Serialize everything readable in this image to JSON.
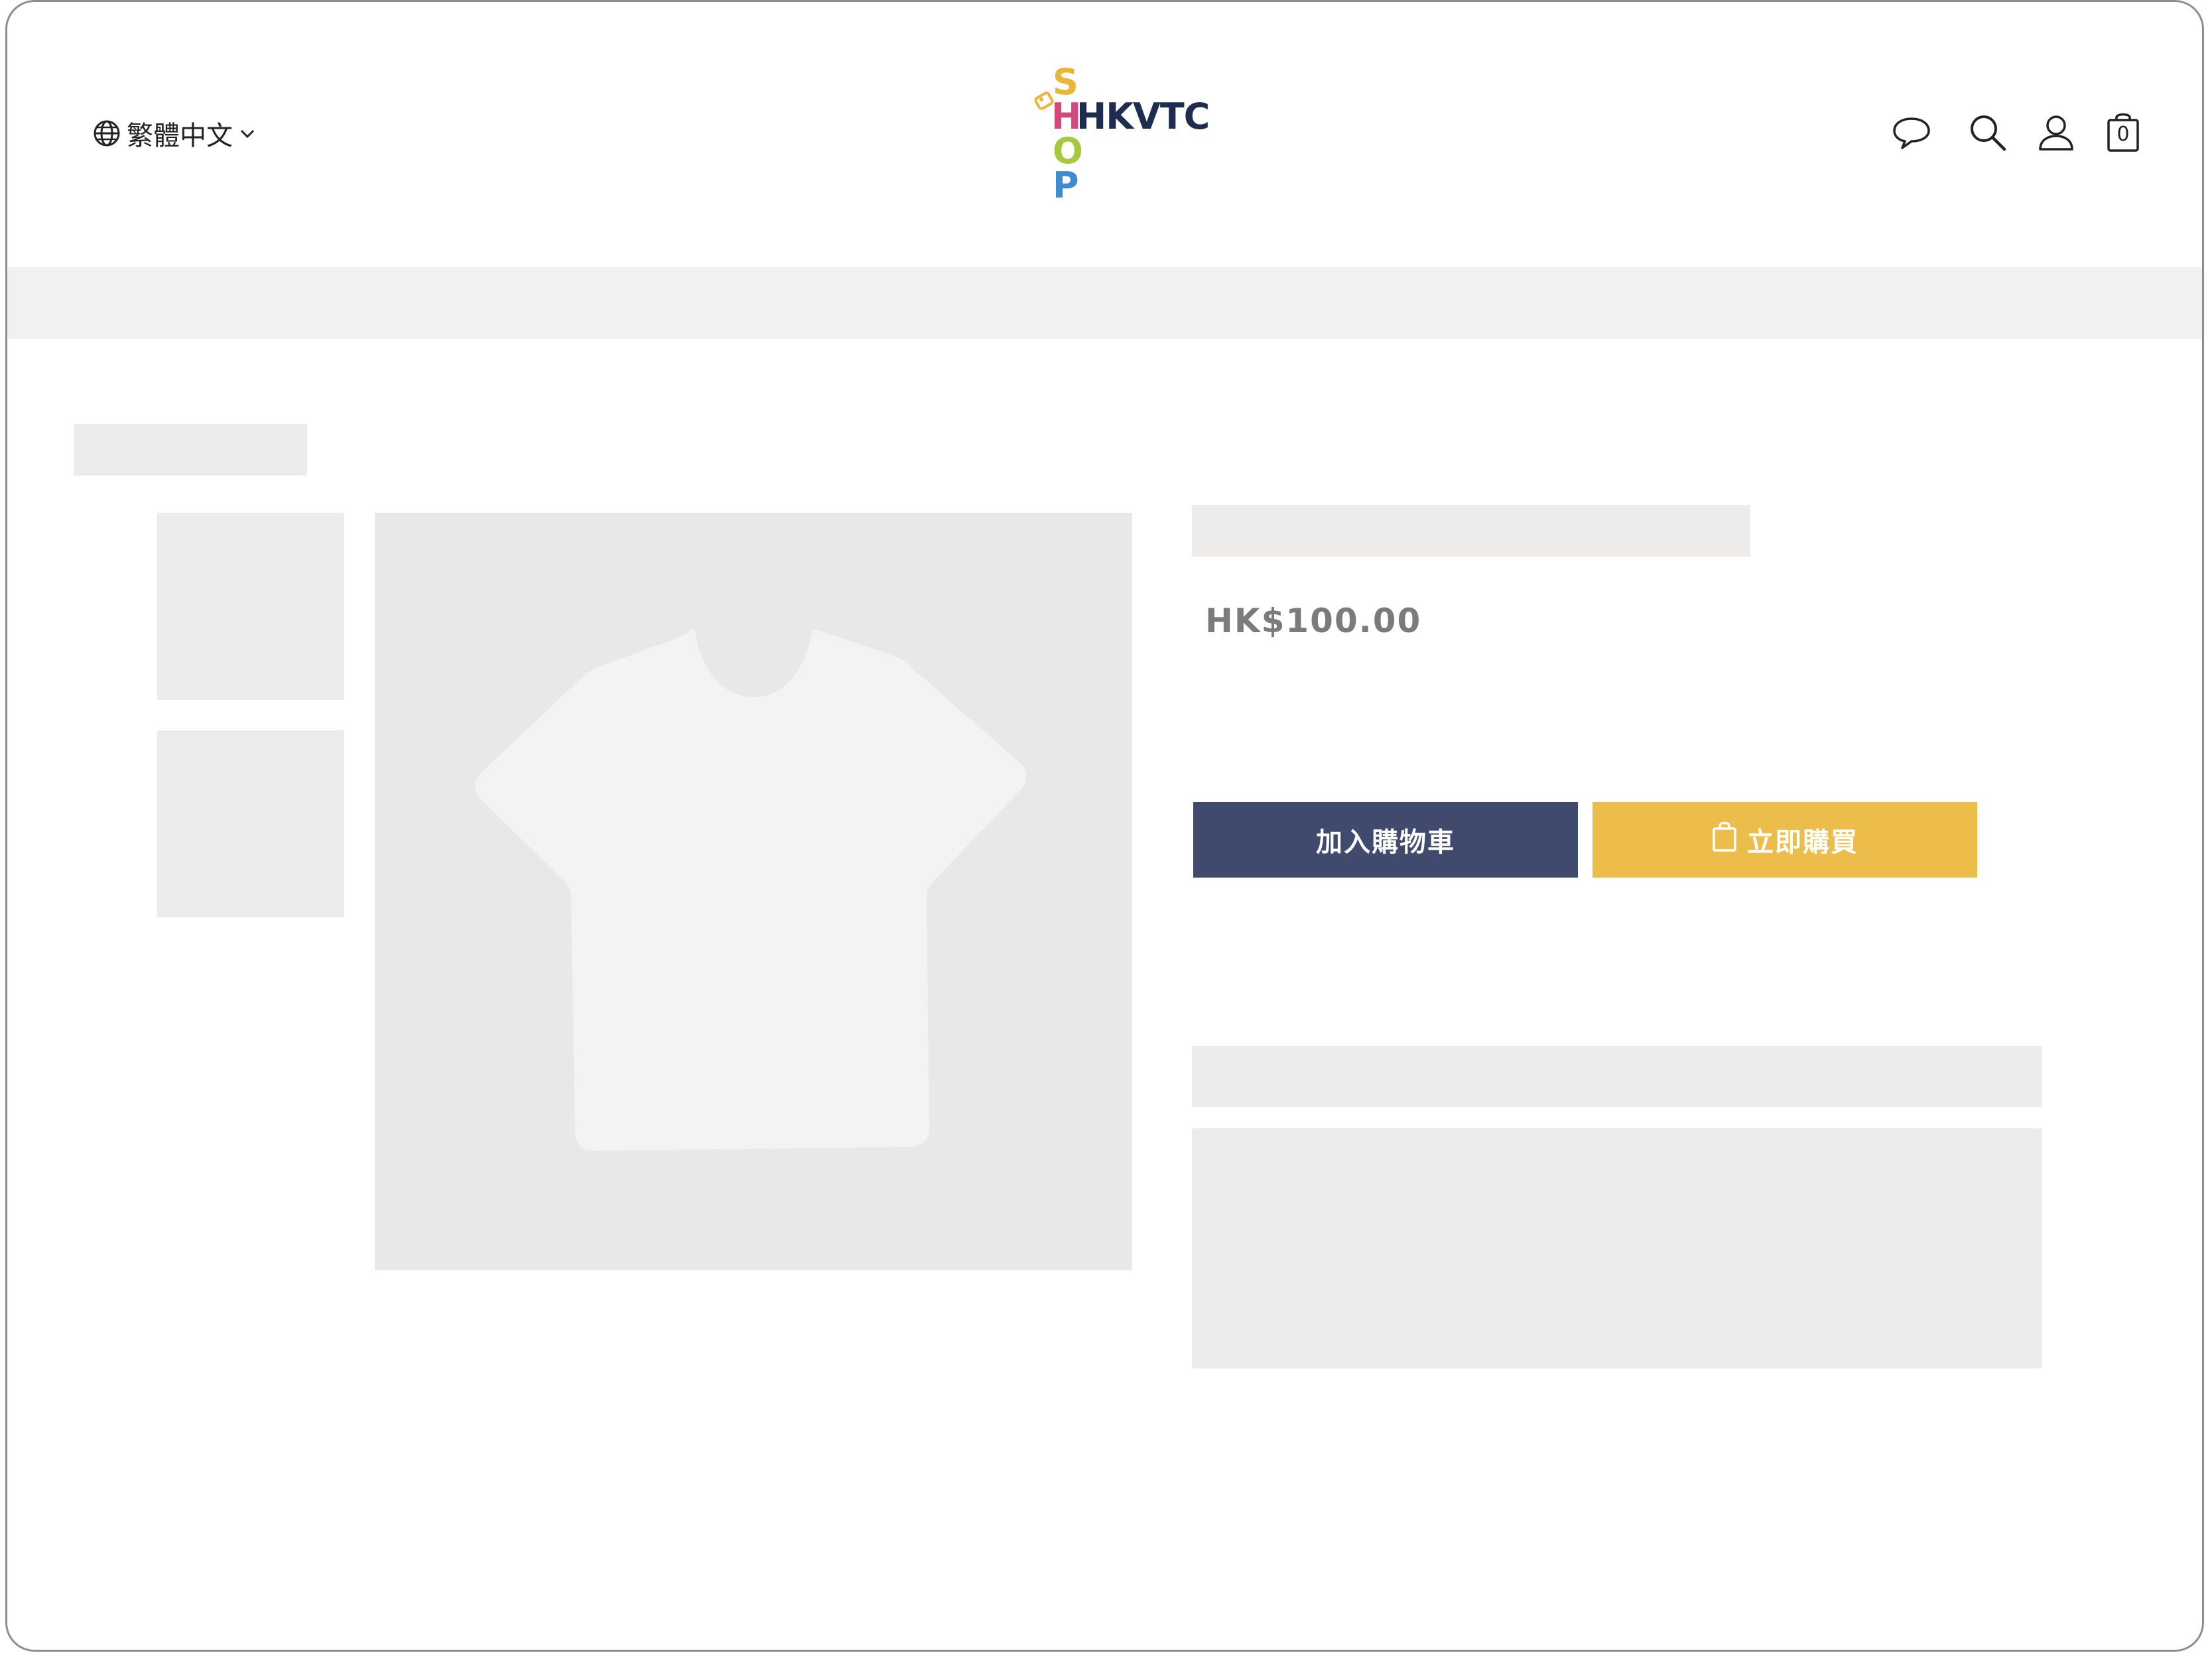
{
  "header": {
    "language_label": "繁體中文",
    "logo": {
      "text": "HKVTC",
      "vertical_letters": [
        "S",
        "H",
        "O",
        "P"
      ],
      "colors": {
        "S": "#e9b53a",
        "H": "#d5487f",
        "O": "#a6c83c",
        "P": "#3f8bd0",
        "HKVTC": "#1e2d4f"
      }
    },
    "icons": [
      "chat-icon",
      "search-icon",
      "user-icon",
      "cart-icon"
    ],
    "cart_count": "0"
  },
  "product": {
    "price": "HK$100.00",
    "add_to_cart_label": "加入購物車",
    "buy_now_label": "立即購買"
  },
  "colors": {
    "primary_button": "#3f4a6c",
    "buy_button": "#ecbd4b",
    "price_text": "#7b7b7b",
    "skeleton": "#edecea"
  }
}
